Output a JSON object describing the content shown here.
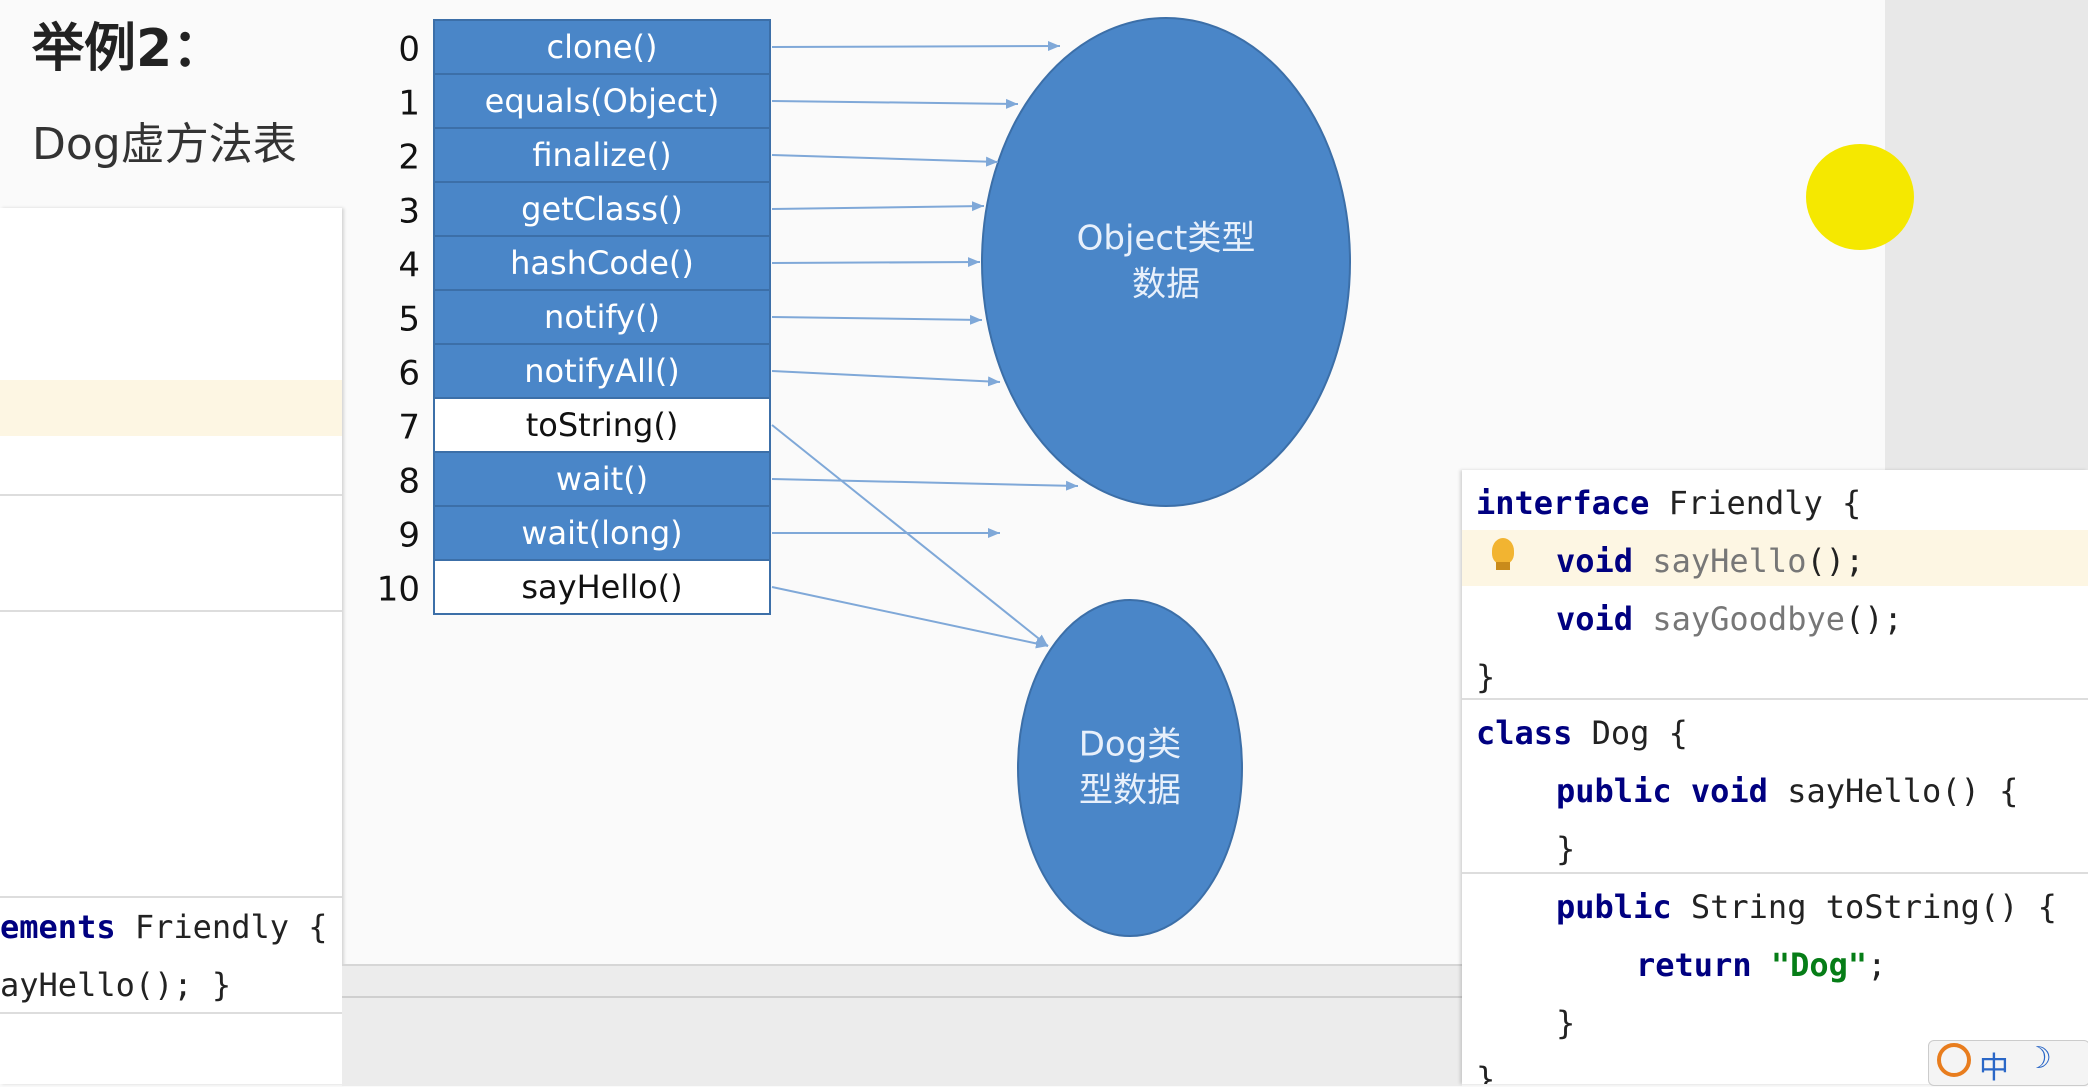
{
  "heading": {
    "title": "举例2：",
    "subtitle": "Dog虚方法表"
  },
  "vtable": {
    "rows": [
      {
        "index": "0",
        "method": "clone()",
        "owner": "object"
      },
      {
        "index": "1",
        "method": "equals(Object)",
        "owner": "object"
      },
      {
        "index": "2",
        "method": "finalize()",
        "owner": "object"
      },
      {
        "index": "3",
        "method": "getClass()",
        "owner": "object"
      },
      {
        "index": "4",
        "method": "hashCode()",
        "owner": "object"
      },
      {
        "index": "5",
        "method": "notify()",
        "owner": "object"
      },
      {
        "index": "6",
        "method": "notifyAll()",
        "owner": "object"
      },
      {
        "index": "7",
        "method": "toString()",
        "owner": "dog"
      },
      {
        "index": "8",
        "method": "wait()",
        "owner": "object"
      },
      {
        "index": "9",
        "method": "wait(long)",
        "owner": "object"
      },
      {
        "index": "10",
        "method": "sayHello()",
        "owner": "dog"
      }
    ]
  },
  "nodes": {
    "object": {
      "label_line1": "Object类型",
      "label_line2": "数据"
    },
    "dog": {
      "label_line1": "Dog类",
      "label_line2": "型数据"
    }
  },
  "left_code": {
    "line1_kw": "ements",
    "line1_rest": " Friendly {",
    "line2": "ayHello(); }"
  },
  "code_panel": {
    "l1_kw": "interface",
    "l1_rest": " Friendly {",
    "l2_kw": "void",
    "l2_name": "sayHello",
    "l2_rest": "();",
    "l3_kw": "void",
    "l3_name": "sayGoodbye",
    "l3_rest": "();",
    "l4": "}",
    "l5_kw": "class",
    "l5_rest": " Dog {",
    "l6_kw": "public void",
    "l6_rest": " sayHello() {",
    "l7": "}",
    "l8_kw": "public",
    "l8_rest": " String toString() {",
    "l9_kw": "return",
    "l9_str": "\"Dog\"",
    "l9_rest": ";",
    "l10": "}",
    "l11": "}"
  },
  "ime": {
    "label": "中"
  },
  "colors": {
    "cell_fill": "#4a86c8",
    "cell_border": "#3c6fa8",
    "node_fill": "#4a86c8",
    "arrow": "#7fa8d8"
  }
}
